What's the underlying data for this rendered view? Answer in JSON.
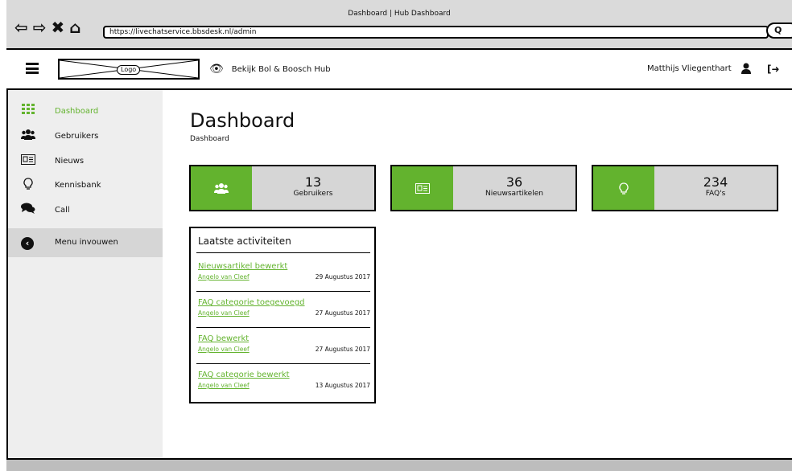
{
  "browser": {
    "window_title": "Dashboard | Hub Dashboard",
    "url": "https://livechatservice.bbsdesk.nl/admin",
    "search_glyph": "Q"
  },
  "header": {
    "logo_label": "Logo",
    "view_hub_label": "Bekijk Bol & Boosch Hub",
    "user_name": "Matthijs Vliegenthart"
  },
  "sidebar": {
    "items": [
      {
        "label": "Dashboard",
        "icon": "grid-icon",
        "active": true
      },
      {
        "label": "Gebruikers",
        "icon": "users-icon"
      },
      {
        "label": "Nieuws",
        "icon": "newspaper-icon"
      },
      {
        "label": "Kennisbank",
        "icon": "lightbulb-icon"
      },
      {
        "label": "Call",
        "icon": "comments-icon"
      }
    ],
    "collapse_label": "Menu invouwen"
  },
  "main": {
    "title": "Dashboard",
    "breadcrumb": "Dashboard",
    "stats": [
      {
        "value": "13",
        "label": "Gebruikers",
        "icon": "users-icon"
      },
      {
        "value": "36",
        "label": "Nieuwsartikelen",
        "icon": "newspaper-icon"
      },
      {
        "value": "234",
        "label": "FAQ's",
        "icon": "lightbulb-icon"
      }
    ],
    "activity": {
      "title": "Laatste activiteiten",
      "items": [
        {
          "title": "Nieuwsartikel bewerkt",
          "author": "Angelo van Cleef",
          "date": "29 Augustus 2017"
        },
        {
          "title": "FAQ categorie toegevoegd",
          "author": "Angelo van Cleef",
          "date": "27 Augustus 2017"
        },
        {
          "title": "FAQ bewerkt",
          "author": "Angelo van Cleef",
          "date": "27 Augustus 2017"
        },
        {
          "title": "FAQ categorie bewerkt",
          "author": "Angelo van Cleef",
          "date": "13 Augustus 2017"
        }
      ]
    }
  },
  "colors": {
    "accent": "#63b32e",
    "sidebar_bg": "#eeeeee",
    "card_bg": "#d6d6d6"
  }
}
